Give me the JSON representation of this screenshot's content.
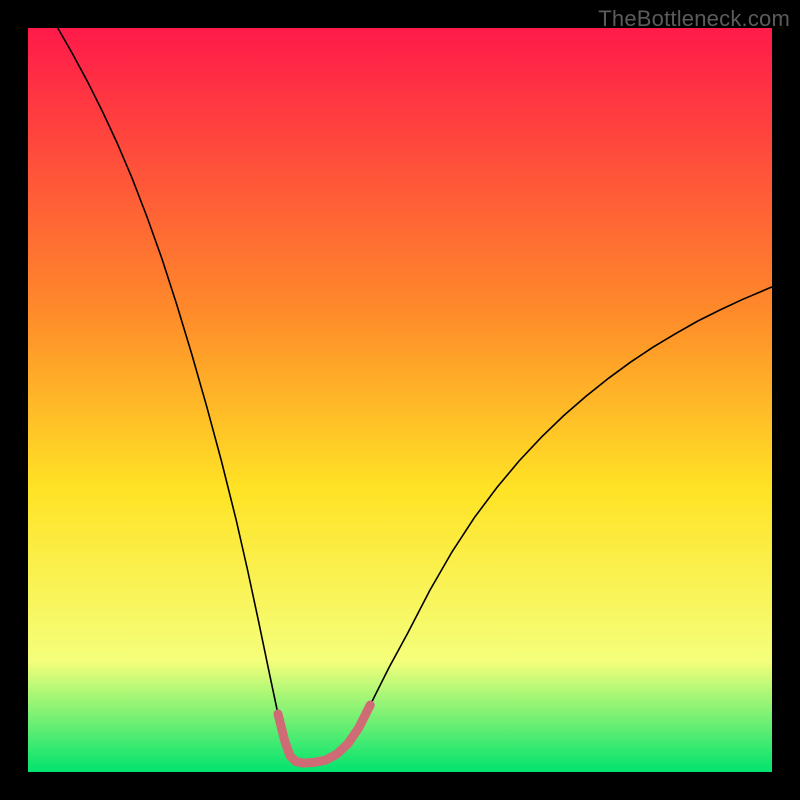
{
  "watermark": "TheBottleneck.com",
  "chart_data": {
    "type": "line",
    "title": "",
    "xlabel": "",
    "ylabel": "",
    "xlim": [
      0,
      100
    ],
    "ylim": [
      0,
      100
    ],
    "grid": false,
    "legend": false,
    "background_gradient": {
      "top": "#ff1a4a",
      "mid_upper": "#ff8a2a",
      "mid": "#ffe325",
      "mid_lower": "#f5ff7a",
      "bottom": "#00e36e"
    },
    "series": [
      {
        "name": "bottleneck-curve",
        "color": "#000000",
        "width": 1.6,
        "x": [
          4,
          6,
          8,
          10,
          12,
          14,
          16,
          18,
          20,
          22,
          24,
          26,
          28,
          29.5,
          31,
          32.5,
          33.6,
          34.5,
          35.2,
          36,
          37,
          38.5,
          40,
          41.5,
          43,
          44.5,
          46,
          48.5,
          51,
          54,
          57,
          60,
          63,
          66,
          69,
          72,
          75,
          78,
          81,
          84,
          87,
          90,
          93,
          96,
          100
        ],
        "y": [
          100,
          96.5,
          92.8,
          88.8,
          84.5,
          79.8,
          74.6,
          69,
          62.8,
          56.2,
          49.2,
          41.8,
          33.8,
          27.2,
          20.2,
          13,
          7.8,
          4.2,
          2.2,
          1.4,
          1.2,
          1.3,
          1.6,
          2.4,
          3.8,
          6,
          9,
          14,
          18.6,
          24.4,
          29.6,
          34.2,
          38.2,
          41.8,
          45,
          47.9,
          50.5,
          52.9,
          55.1,
          57.1,
          58.9,
          60.6,
          62.1,
          63.5,
          65.2
        ]
      },
      {
        "name": "valley-highlight",
        "color": "#cf6b74",
        "width": 9,
        "linecap": "round",
        "x": [
          33.6,
          34.5,
          35.2,
          36,
          37,
          38.5,
          40,
          41.5,
          43,
          44.5,
          46
        ],
        "y": [
          7.8,
          4.2,
          2.2,
          1.4,
          1.2,
          1.3,
          1.6,
          2.4,
          3.8,
          6,
          9
        ]
      }
    ]
  }
}
